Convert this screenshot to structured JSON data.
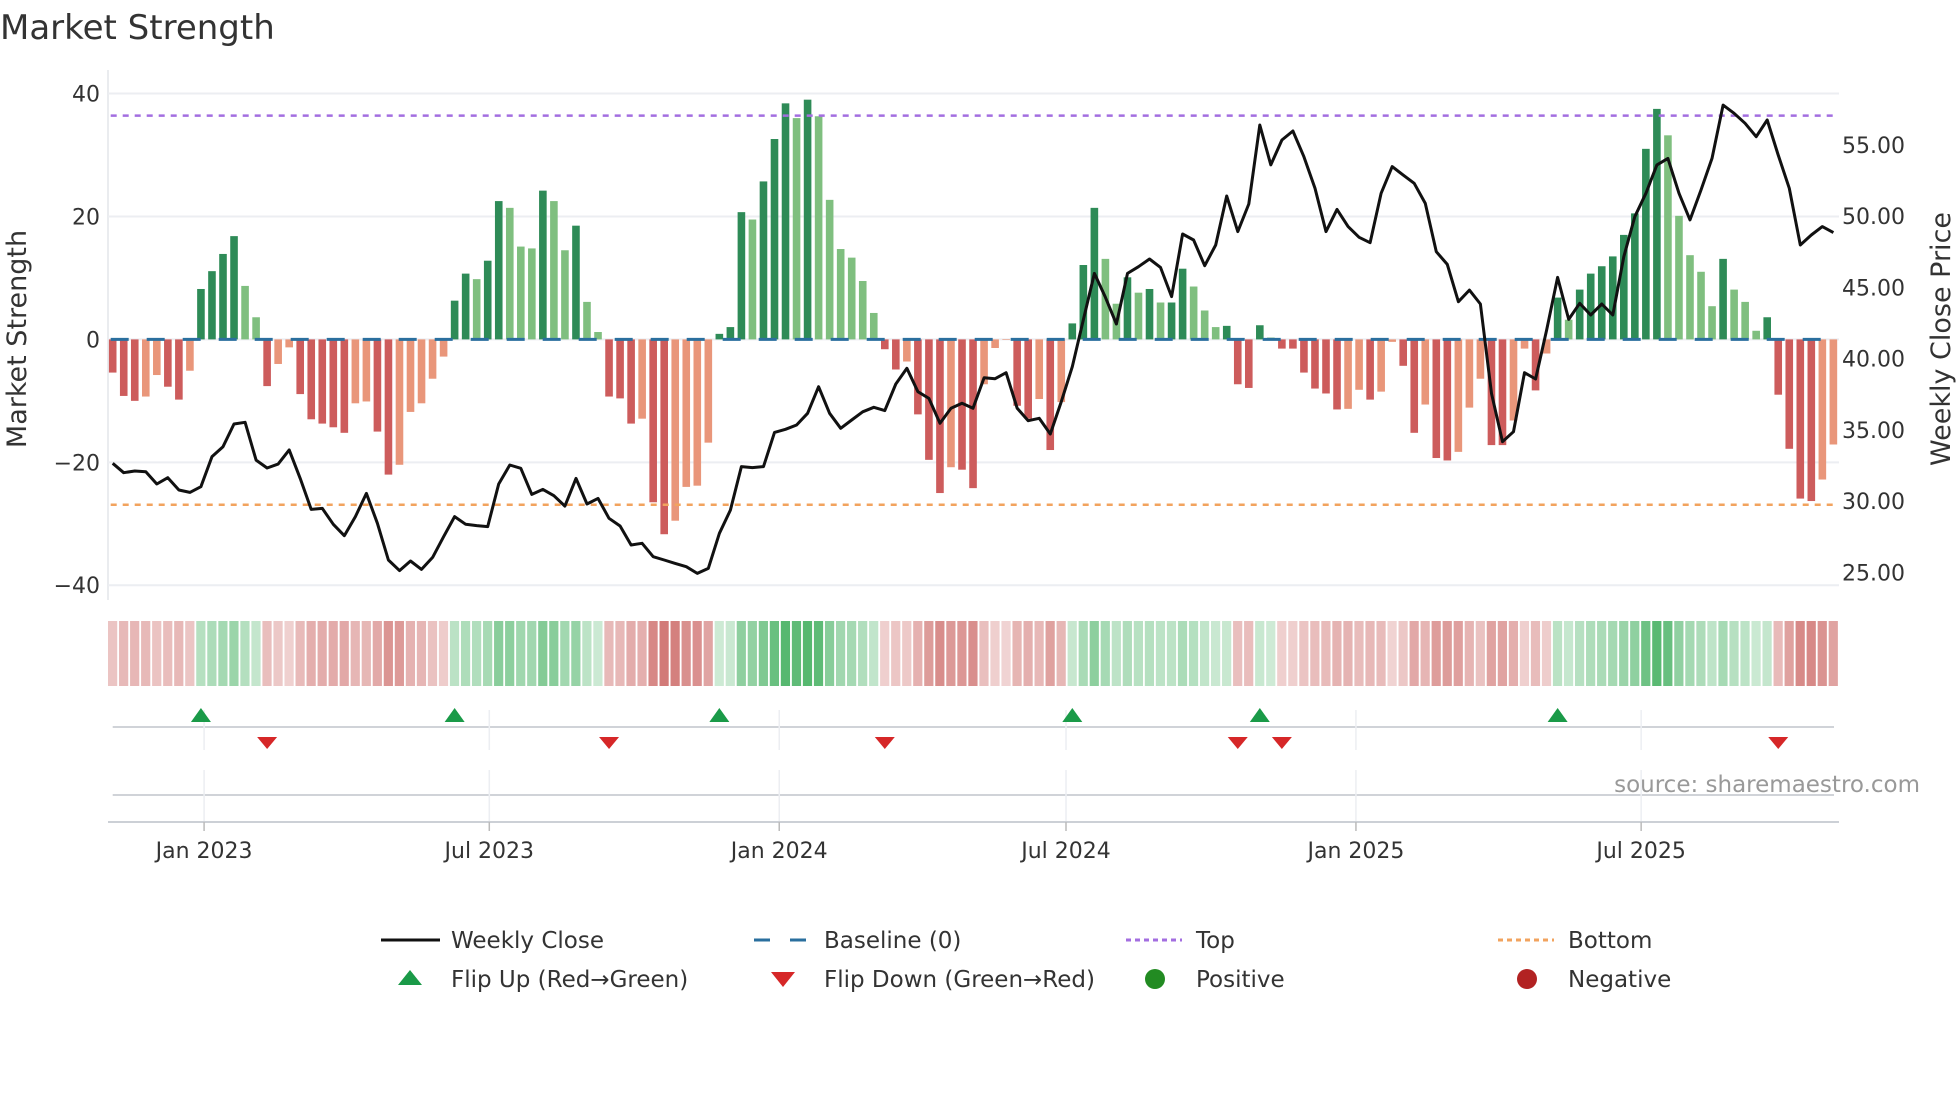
{
  "chart_data": {
    "type": "bar",
    "title": "Market Strength",
    "ylabel": "Market Strength",
    "ylabel_right": "Weekly Close Price",
    "start_date": "2022-11-04",
    "frequency": "weekly",
    "ylim": [
      -42.4,
      42.2
    ],
    "ylim_right": [
      23.07,
      59.56
    ],
    "yticks": [
      40,
      20,
      0,
      -20,
      -40
    ],
    "ytick_labels": [
      "40",
      "20",
      "0",
      "−20",
      "−40"
    ],
    "yticks_right": [
      55,
      50,
      45,
      40,
      35,
      30,
      25
    ],
    "ytick_labels_right": [
      "55.00",
      "50.00",
      "45.00",
      "40.00",
      "35.00",
      "30.00",
      "25.00"
    ],
    "xticks": [
      {
        "date": "2023-01-01",
        "label": "Jan 2023"
      },
      {
        "date": "2023-07-01",
        "label": "Jul 2023"
      },
      {
        "date": "2024-01-01",
        "label": "Jan 2024"
      },
      {
        "date": "2024-07-01",
        "label": "Jul 2024"
      },
      {
        "date": "2025-01-01",
        "label": "Jan 2025"
      },
      {
        "date": "2025-07-01",
        "label": "Jul 2025"
      }
    ],
    "top_level": 36.4,
    "bottom_level": -26.9,
    "baseline": 0,
    "strength": [
      -5.4,
      -9.2,
      -10,
      -9.3,
      -5.8,
      -7.7,
      -9.8,
      -5.1,
      8.2,
      11.1,
      13.9,
      16.8,
      8.7,
      3.6,
      -7.6,
      -4,
      -1.3,
      -8.9,
      -13,
      -13.7,
      -14.3,
      -15.2,
      -10.4,
      -10.1,
      -15,
      -22,
      -20.4,
      -11.8,
      -10.4,
      -6.4,
      -2.8,
      6.3,
      10.7,
      9.8,
      12.8,
      22.5,
      21.4,
      15.1,
      14.8,
      24.2,
      22.5,
      14.5,
      18.5,
      6.1,
      1.2,
      -9.3,
      -9.6,
      -13.7,
      -12.9,
      -26.5,
      -31.7,
      -29.5,
      -24,
      -23.8,
      -16.8,
      0.9,
      2,
      20.7,
      19.5,
      25.7,
      32.6,
      38.4,
      36,
      39,
      36.3,
      22.7,
      14.7,
      13.3,
      9.5,
      4.3,
      -1.6,
      -4.9,
      -3.6,
      -12.2,
      -19.6,
      -25,
      -20.8,
      -21.2,
      -24.2,
      -7.3,
      -1.4,
      -0.1,
      -10.8,
      -12.9,
      -9.7,
      -18,
      -10.2,
      2.6,
      12.1,
      21.4,
      13.1,
      5.8,
      10.1,
      7.6,
      8.2,
      6,
      6,
      11.5,
      8.6,
      4.7,
      2,
      2.2,
      -7.3,
      -7.9,
      2.3,
      0.3,
      -1.5,
      -1.5,
      -5.4,
      -8,
      -8.8,
      -11.4,
      -11.3,
      -8.2,
      -9.8,
      -8.5,
      -0.4,
      -4.3,
      -15.2,
      -10.6,
      -19.3,
      -19.7,
      -18.3,
      -11.1,
      -6.4,
      -17.2,
      -17.2,
      -13.2,
      -1.5,
      -8.3,
      -2.3,
      6.8,
      3.2,
      8.1,
      10.7,
      11.9,
      13.5,
      17,
      20.5,
      31,
      37.5,
      33.2,
      20.1,
      13.7,
      11,
      5.4,
      13.1,
      8.1,
      6.1,
      1.4,
      3.6,
      -9,
      -17.8,
      -25.9,
      -26.3,
      -22.8,
      -17.1
    ],
    "weekly_close": [
      32.66,
      32.0,
      32.12,
      32.07,
      31.21,
      31.65,
      30.79,
      30.62,
      31.02,
      33.13,
      33.83,
      35.42,
      35.54,
      32.89,
      32.33,
      32.61,
      33.6,
      31.6,
      29.43,
      29.5,
      28.38,
      27.58,
      28.92,
      30.55,
      28.45,
      25.88,
      25.13,
      25.81,
      25.22,
      26.06,
      27.51,
      28.92,
      28.38,
      28.29,
      28.22,
      31.21,
      32.54,
      32.31,
      30.48,
      30.83,
      30.39,
      29.66,
      31.6,
      29.81,
      30.2,
      28.8,
      28.26,
      26.93,
      27.05,
      26.11,
      25.88,
      25.64,
      25.41,
      24.94,
      25.29,
      27.75,
      29.38,
      32.43,
      32.36,
      32.43,
      34.83,
      35.05,
      35.35,
      36.17,
      38.04,
      36.17,
      35.12,
      35.7,
      36.28,
      36.59,
      36.36,
      38.23,
      39.33,
      37.69,
      37.22,
      35.47,
      36.52,
      36.87,
      36.52,
      38.67,
      38.6,
      39.02,
      36.52,
      35.65,
      35.82,
      34.72,
      36.99,
      39.44,
      42.72,
      45.99,
      44.31,
      42.44,
      45.99,
      46.46,
      47.0,
      46.41,
      44.36,
      48.75,
      48.33,
      46.53,
      47.98,
      51.42,
      48.92,
      50.86,
      56.4,
      53.6,
      55.35,
      55.98,
      54.18,
      51.96,
      48.92,
      50.48,
      49.27,
      48.52,
      48.14,
      51.61,
      53.48,
      52.89,
      52.31,
      50.9,
      47.51,
      46.62,
      44.0,
      44.82,
      43.84,
      37.57,
      34.18,
      34.88,
      39.02,
      38.58,
      42.0,
      45.71,
      42.76,
      43.89,
      43.07,
      43.84,
      43.07,
      47.16,
      49.97,
      51.61,
      53.6,
      54.06,
      51.61,
      49.74,
      51.84,
      54.06,
      57.8,
      57.22,
      56.52,
      55.58,
      56.75,
      54.3,
      51.96,
      47.98,
      48.68,
      49.27,
      48.85
    ],
    "legend": {
      "placement": "bottom",
      "entries": [
        {
          "key": "close",
          "label": "Weekly Close"
        },
        {
          "key": "baseline",
          "label": "Baseline (0)"
        },
        {
          "key": "top",
          "label": "Top"
        },
        {
          "key": "bottom",
          "label": "Bottom"
        },
        {
          "key": "flip_up",
          "label": "Flip Up (Red→Green)"
        },
        {
          "key": "flip_down",
          "label": "Flip Down (Green→Red)"
        },
        {
          "key": "positive",
          "label": "Positive"
        },
        {
          "key": "negative",
          "label": "Negative"
        }
      ]
    },
    "source": "source: sharemaestro.com"
  },
  "colors": {
    "pos_strong": "#2e8b57",
    "pos_weak": "#7fbf7f",
    "neg_strong": "#cd5c5c",
    "neg_weak": "#e9967a",
    "close": "#111111",
    "baseline": "#2a6f9e",
    "top": "#a36ee0",
    "bottom": "#f2a35e",
    "flip_up": "#1a9a48",
    "flip_down": "#d62728",
    "positive": "#228b22",
    "negative": "#b22222",
    "grid": "#eceef2"
  }
}
